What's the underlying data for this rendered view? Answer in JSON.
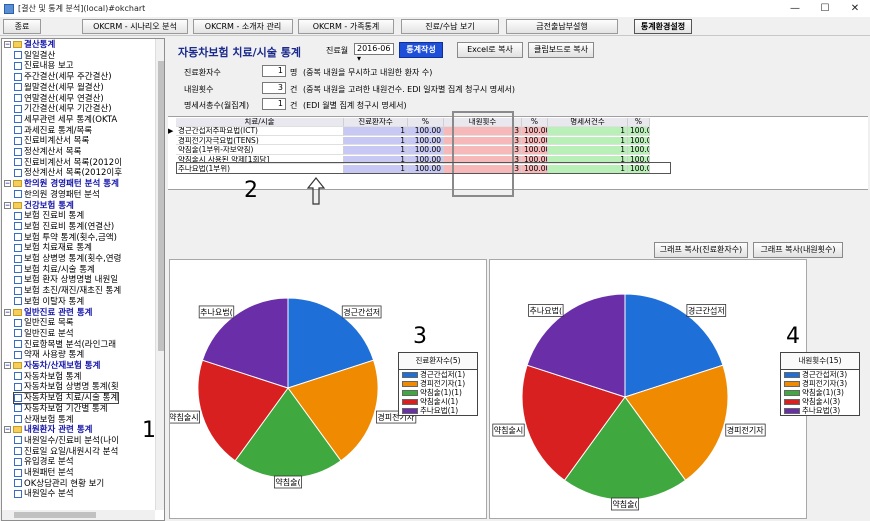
{
  "window": {
    "title": "[결산 및 통계 분석](local)#okchart"
  },
  "toolbar": {
    "btn_close": "종료",
    "btn_scenario": "OKCRM - 시나리오 분석",
    "btn_referrer": "OKCRM - 소개자 관리",
    "btn_family": "OKCRM - 가족통계",
    "btn_receipt": "진료/수납 보기",
    "btn_cashbook": "금전출납부설행",
    "btn_settings": "통계환경설정"
  },
  "tree": {
    "nodes": [
      {
        "label": "결산통계",
        "type": "group",
        "level": 0
      },
      {
        "label": "일일결산",
        "type": "doc",
        "level": 1
      },
      {
        "label": "진료내용 보고",
        "type": "doc",
        "level": 1
      },
      {
        "label": "주간결산(세무 주간결산)",
        "type": "doc",
        "level": 1
      },
      {
        "label": "월말결산(세무 월결산)",
        "type": "doc",
        "level": 1
      },
      {
        "label": "연말결산(세무 연결산)",
        "type": "doc",
        "level": 1
      },
      {
        "label": "기간결산(세무 기간결산)",
        "type": "doc",
        "level": 1
      },
      {
        "label": "세무관련 세무 통계(OKTA",
        "type": "doc",
        "level": 1
      },
      {
        "label": "과세진료 통계/목록",
        "type": "doc",
        "level": 1
      },
      {
        "label": "진료비계산서 목록",
        "type": "doc",
        "level": 1
      },
      {
        "label": "정산계산서 목록",
        "type": "doc",
        "level": 1
      },
      {
        "label": "진료비계산서 목록(2012이",
        "type": "doc",
        "level": 1
      },
      {
        "label": "정산계산서 목록(2012이후",
        "type": "doc",
        "level": 1
      },
      {
        "label": "한의원 경영패턴 분석 통계",
        "type": "group",
        "level": 0
      },
      {
        "label": "한의원 경영패턴 분석",
        "type": "doc",
        "level": 1
      },
      {
        "label": "건강보험 통계",
        "type": "group",
        "level": 0
      },
      {
        "label": "보험 진료비 통계",
        "type": "doc",
        "level": 1
      },
      {
        "label": "보험 진료비 통계(연결산)",
        "type": "doc",
        "level": 1
      },
      {
        "label": "보험 투약 통계(횟수,금액)",
        "type": "doc",
        "level": 1
      },
      {
        "label": "보험 치료재료 통계",
        "type": "doc",
        "level": 1
      },
      {
        "label": "보험 상병명 통계(횟수,연령",
        "type": "doc",
        "level": 1
      },
      {
        "label": "보험 치료/시술 통계",
        "type": "doc",
        "level": 1
      },
      {
        "label": "보험 환자 상병명별 내원일",
        "type": "doc",
        "level": 1
      },
      {
        "label": "보험 초진/재진/재초진 통계",
        "type": "doc",
        "level": 1
      },
      {
        "label": "보험 이탈자 통계",
        "type": "doc",
        "level": 1
      },
      {
        "label": "일반진료 관련 통계",
        "type": "group",
        "level": 0
      },
      {
        "label": "일반진료 목록",
        "type": "doc",
        "level": 1
      },
      {
        "label": "일반진료 분석",
        "type": "doc",
        "level": 1
      },
      {
        "label": "진료항목별 분석(라인그래",
        "type": "doc",
        "level": 1
      },
      {
        "label": "약재 사용량 통계",
        "type": "doc",
        "level": 1
      },
      {
        "label": "자동차/산재보험 통계",
        "type": "group",
        "level": 0
      },
      {
        "label": "자동차보험 통계",
        "type": "doc",
        "level": 1
      },
      {
        "label": "자동차보험 상병명 통계(횟",
        "type": "doc",
        "level": 1
      },
      {
        "label": "자동차보험 치료/시술 통계",
        "type": "doc",
        "level": 1,
        "selected": true
      },
      {
        "label": "자동차보험 기간별 통계",
        "type": "doc",
        "level": 1
      },
      {
        "label": "산재보험 통계",
        "type": "doc",
        "level": 1
      },
      {
        "label": "내원환자 관련 통계",
        "type": "group",
        "level": 0
      },
      {
        "label": "내원일수/진료비 분석(나이",
        "type": "doc",
        "level": 1
      },
      {
        "label": "진료일 요일/내원시각 분석",
        "type": "doc",
        "level": 1
      },
      {
        "label": "유입경로 분석",
        "type": "doc",
        "level": 1
      },
      {
        "label": "내원패턴 분석",
        "type": "doc",
        "level": 1
      },
      {
        "label": "OK상담관리 현황 보기",
        "type": "doc",
        "level": 1
      },
      {
        "label": "내원일수 분석",
        "type": "doc",
        "level": 1
      }
    ]
  },
  "main": {
    "title": "자동차보험 치료/시술 통계",
    "period_label": "진료월",
    "period_value": "2016-06",
    "btn_run": "통계작성",
    "btn_excel": "Excel로 복사",
    "btn_clipboard": "클립보드로 복사",
    "stats": [
      {
        "label": "진료환자수",
        "value": "1",
        "unit": "명",
        "note": "(중복 내원을 무시하고 내원한 환자 수)"
      },
      {
        "label": "내원횟수",
        "value": "3",
        "unit": "건",
        "note": "(중복 내원을 고려한 내원건수. EDI 일자별 집계 청구시 명세서)"
      },
      {
        "label": "명세서총수(월집계)",
        "value": "1",
        "unit": "건",
        "note": "(EDI 월별 집계 청구시 명세서)"
      }
    ]
  },
  "grid": {
    "headers": [
      "치료/시술",
      "진료환자수",
      "%",
      "내원횟수",
      "%",
      "명세서건수",
      "%"
    ],
    "rows": [
      [
        "경근간섭저주파요법(ICT)",
        "1",
        "100.00",
        "3",
        "100.00",
        "1",
        "100.00"
      ],
      [
        "경피전기자극요법(TENS)",
        "1",
        "100.00",
        "3",
        "100.00",
        "1",
        "100.00"
      ],
      [
        "약침술(1부위-자보약침)",
        "1",
        "100.00",
        "3",
        "100.00",
        "1",
        "100.00"
      ],
      [
        "약침술시 사용된 약제[1회당]",
        "1",
        "100.00",
        "3",
        "100.00",
        "1",
        "100.00"
      ],
      [
        "추나요법(1부위)",
        "1",
        "100.00",
        "3",
        "100.00",
        "1",
        "100.00"
      ]
    ]
  },
  "chart_buttons": {
    "copy_patients": "그래프 복사(진료환자수)",
    "copy_visits": "그래프 복사(내원횟수)"
  },
  "annotations": {
    "a1": "1",
    "a2": "2",
    "a3": "3",
    "a4": "4"
  },
  "colors": {
    "blue": "#1f6fd8",
    "orange": "#f08a00",
    "green": "#3fa83f",
    "red": "#d82020",
    "purple": "#6a2fa8"
  },
  "chart_data": [
    {
      "type": "pie",
      "title": "진료환자수(5)",
      "categories": [
        "경근간섭저",
        "경피전기자",
        "약침술",
        "약침술시",
        "추나요법"
      ],
      "legend": [
        "경근간섭저(1)",
        "경피전기자(1)",
        "약침술(1)(1)",
        "약침술시(1)",
        "추나요법(1)"
      ],
      "values": [
        1,
        1,
        1,
        1,
        1
      ],
      "slice_labels": [
        "경근간섭저",
        "경피전기자",
        "약침술(",
        "약침술시",
        "추나요법("
      ]
    },
    {
      "type": "pie",
      "title": "내원횟수(15)",
      "categories": [
        "경근간섭저",
        "경피전기자",
        "약침술",
        "약침술시",
        "추나요법"
      ],
      "legend": [
        "경근간섭저(3)",
        "경피전기자(3)",
        "약침술(1)(3)",
        "약침술시(3)",
        "추나요법(3)"
      ],
      "values": [
        3,
        3,
        3,
        3,
        3
      ],
      "slice_labels": [
        "경근간섭저",
        "경피전기자",
        "약침술(",
        "약침술시",
        "추나요법("
      ]
    }
  ]
}
